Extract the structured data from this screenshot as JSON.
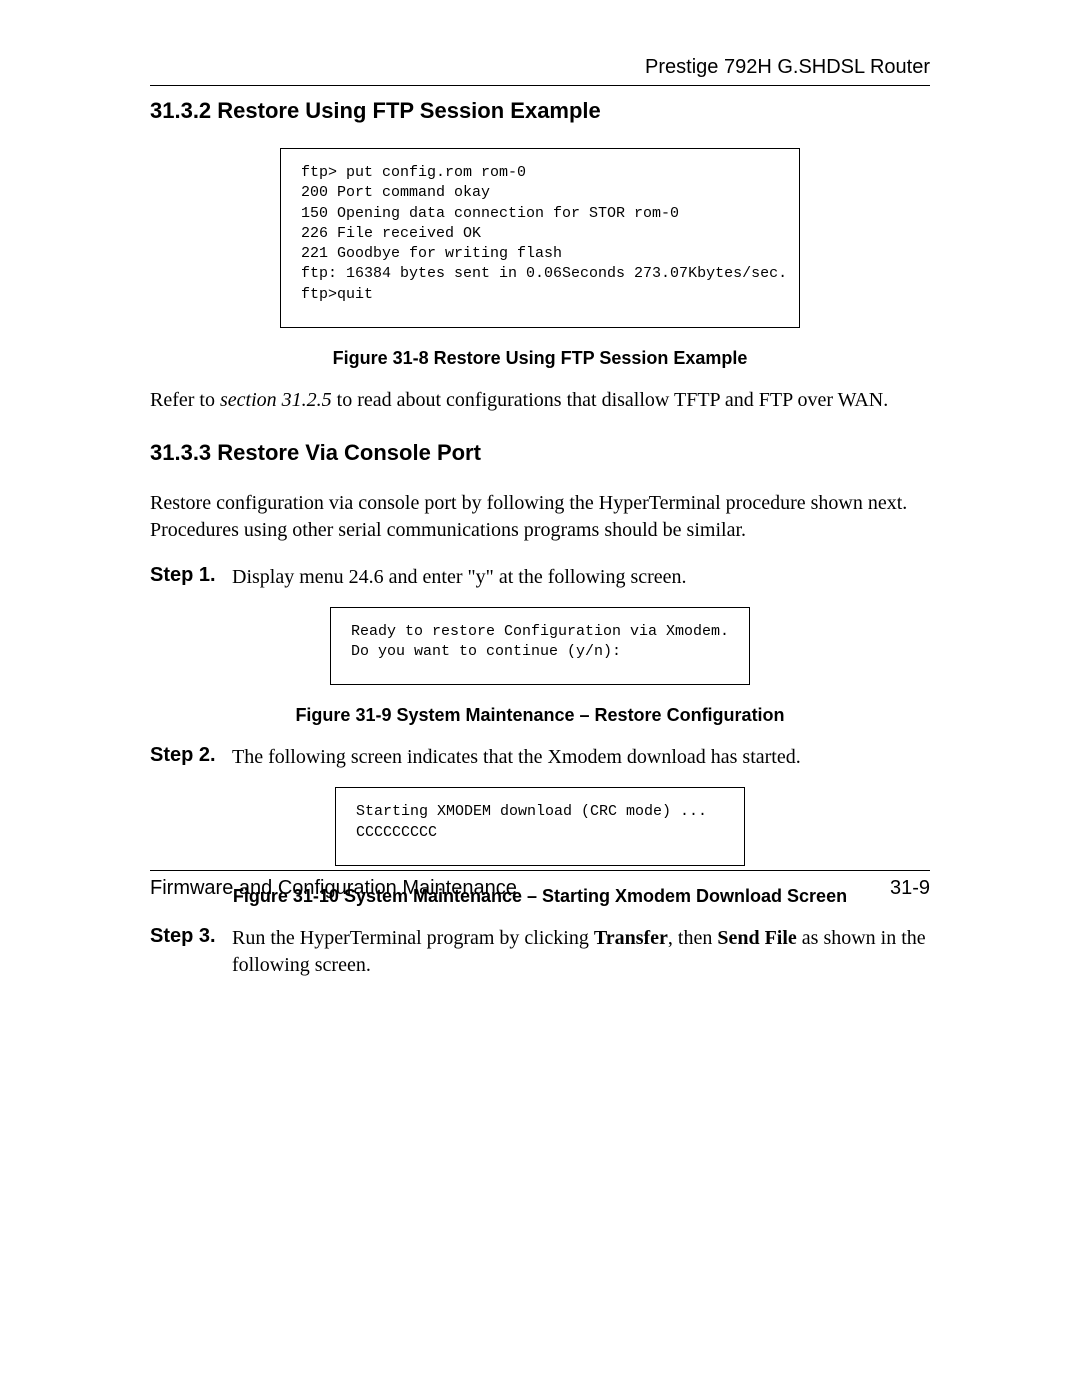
{
  "header": {
    "title": "Prestige 792H G.SHDSL Router"
  },
  "section1": {
    "heading": "31.3.2 Restore Using FTP Session Example",
    "code": "ftp> put config.rom rom-0\n200 Port command okay\n150 Opening data connection for STOR rom-0\n226 File received OK\n221 Goodbye for writing flash\nftp: 16384 bytes sent in 0.06Seconds 273.07Kbytes/sec.\nftp>quit",
    "caption": "Figure 31-8 Restore Using FTP Session Example",
    "refer_before": "Refer to ",
    "refer_italic": "section 31.2.5",
    "refer_after": " to read about configurations that disallow TFTP and FTP over WAN."
  },
  "section2": {
    "heading": "31.3.3 Restore Via Console Port",
    "intro": "Restore configuration via console port by following the HyperTerminal procedure shown next. Procedures using other serial communications programs should be similar.",
    "step1_label": "Step 1.",
    "step1_text": "Display menu 24.6 and enter \"y\" at the following screen.",
    "code1": "Ready to restore Configuration via Xmodem.\nDo you want to continue (y/n):",
    "caption1": "Figure 31-9 System Maintenance – Restore Configuration",
    "step2_label": "Step 2.",
    "step2_text": "The following screen indicates that the Xmodem download has started.",
    "code2": "Starting XMODEM download (CRC mode) ...\nCCCCCCCCC",
    "caption2": "Figure 31-10 System Maintenance – Starting Xmodem Download Screen",
    "step3_label": "Step 3.",
    "step3_a": "Run the HyperTerminal program by clicking ",
    "step3_b1": "Transfer",
    "step3_c": ", then ",
    "step3_b2": "Send File",
    "step3_d": " as shown in the following screen."
  },
  "footer": {
    "left": "Firmware and Configuration Maintenance",
    "right": "31-9"
  }
}
